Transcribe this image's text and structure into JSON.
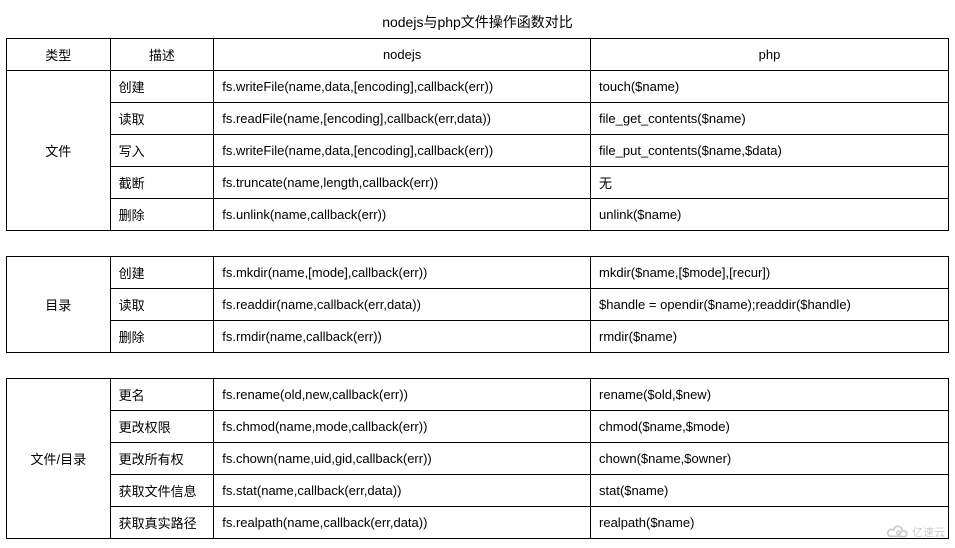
{
  "title": "nodejs与php文件操作函数对比",
  "headers": {
    "type": "类型",
    "desc": "描述",
    "nodejs": "nodejs",
    "php": "php"
  },
  "sections": [
    {
      "type": "文件",
      "rows": [
        {
          "desc": "创建",
          "nodejs": "fs.writeFile(name,data,[encoding],callback(err))",
          "php": "touch($name)"
        },
        {
          "desc": "读取",
          "nodejs": "fs.readFile(name,[encoding],callback(err,data))",
          "php": "file_get_contents($name)"
        },
        {
          "desc": "写入",
          "nodejs": "fs.writeFile(name,data,[encoding],callback(err))",
          "php": "file_put_contents($name,$data)"
        },
        {
          "desc": "截断",
          "nodejs": "fs.truncate(name,length,callback(err))",
          "php": "无"
        },
        {
          "desc": "删除",
          "nodejs": "fs.unlink(name,callback(err))",
          "php": "unlink($name)"
        }
      ]
    },
    {
      "type": "目录",
      "rows": [
        {
          "desc": "创建",
          "nodejs": "fs.mkdir(name,[mode],callback(err))",
          "php": "mkdir($name,[$mode],[recur])"
        },
        {
          "desc": "读取",
          "nodejs": "fs.readdir(name,callback(err,data))",
          "php": "$handle = opendir($name);readdir($handle)"
        },
        {
          "desc": "删除",
          "nodejs": "fs.rmdir(name,callback(err))",
          "php": "rmdir($name)"
        }
      ]
    },
    {
      "type": "文件/目录",
      "rows": [
        {
          "desc": "更名",
          "nodejs": "fs.rename(old,new,callback(err))",
          "php": "rename($old,$new)"
        },
        {
          "desc": "更改权限",
          "nodejs": "fs.chmod(name,mode,callback(err))",
          "php": "chmod($name,$mode)"
        },
        {
          "desc": "更改所有权",
          "nodejs": "fs.chown(name,uid,gid,callback(err))",
          "php": "chown($name,$owner)"
        },
        {
          "desc": "获取文件信息",
          "nodejs": "fs.stat(name,callback(err,data))",
          "php": "stat($name)"
        },
        {
          "desc": "获取真实路径",
          "nodejs": "fs.realpath(name,callback(err,data))",
          "php": "realpath($name)"
        }
      ]
    }
  ],
  "watermark": "亿速云"
}
